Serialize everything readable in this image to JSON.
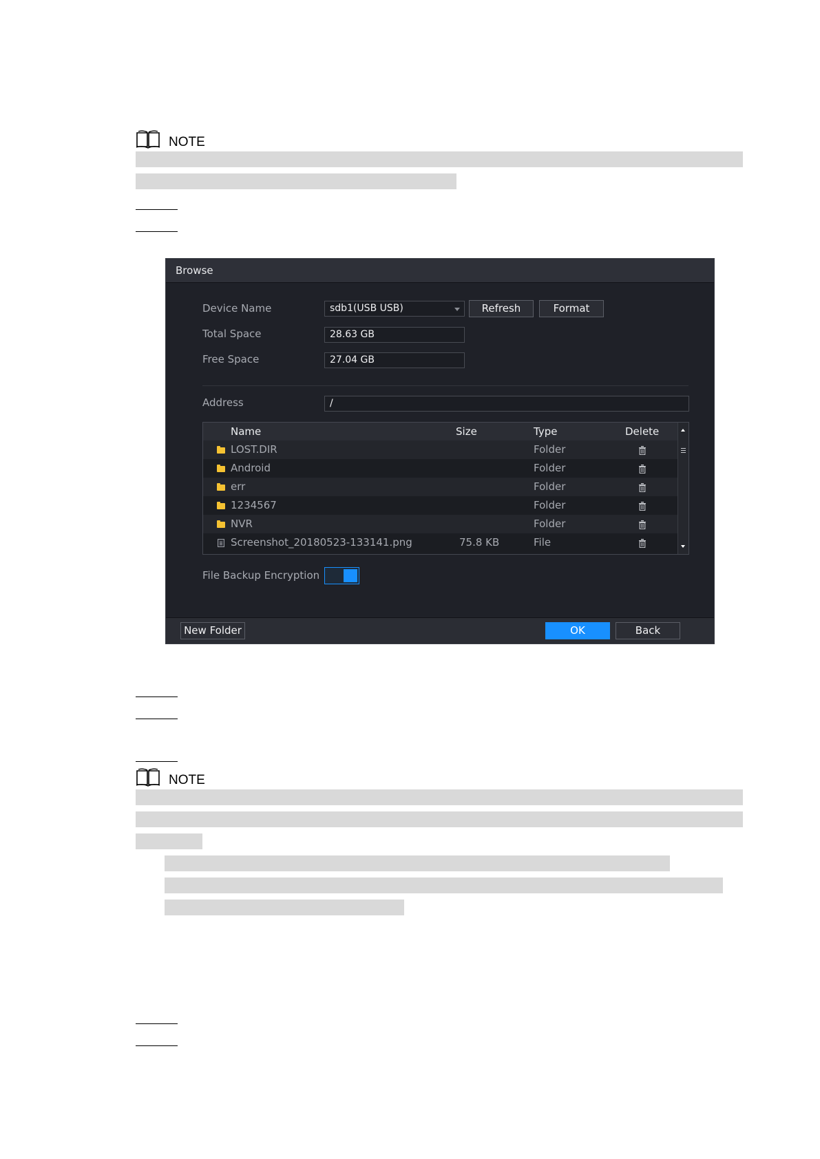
{
  "note_top": {
    "label": "NOTE"
  },
  "note_bottom": {
    "label": "NOTE"
  },
  "dialog": {
    "title": "Browse",
    "device_name": {
      "label": "Device Name",
      "value": "sdb1(USB USB)"
    },
    "refresh_label": "Refresh",
    "format_label": "Format",
    "total_space": {
      "label": "Total Space",
      "value": "28.63 GB"
    },
    "free_space": {
      "label": "Free Space",
      "value": "27.04 GB"
    },
    "address": {
      "label": "Address",
      "value": "/"
    },
    "table": {
      "headers": {
        "name": "Name",
        "size": "Size",
        "type": "Type",
        "delete": "Delete"
      },
      "rows": [
        {
          "icon": "folder-icon",
          "name": "LOST.DIR",
          "size": "",
          "type": "Folder"
        },
        {
          "icon": "folder-icon",
          "name": "Android",
          "size": "",
          "type": "Folder"
        },
        {
          "icon": "folder-icon",
          "name": "err",
          "size": "",
          "type": "Folder"
        },
        {
          "icon": "folder-icon",
          "name": "1234567",
          "size": "",
          "type": "Folder"
        },
        {
          "icon": "folder-icon",
          "name": "NVR",
          "size": "",
          "type": "Folder"
        },
        {
          "icon": "file-icon",
          "name": "Screenshot_20180523-133141.png",
          "size": "75.8 KB",
          "type": "File"
        }
      ]
    },
    "encryption": {
      "label": "File Backup Encryption",
      "enabled": true
    },
    "footer": {
      "new_folder_label": "New Folder",
      "ok_label": "OK",
      "back_label": "Back"
    }
  },
  "colors": {
    "accent": "#1890ff",
    "dialog_bg": "#1f2128",
    "folder": "#f5c232",
    "redaction": "#d9d9d9"
  }
}
